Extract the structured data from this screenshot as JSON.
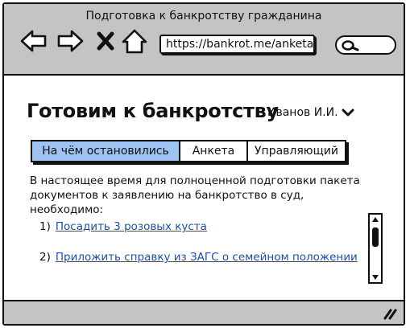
{
  "window": {
    "title": "Подготовка к банкротству гражданина"
  },
  "toolbar": {
    "back_icon": "arrow-left-icon",
    "forward_icon": "arrow-right-icon",
    "stop_icon": "close-icon",
    "home_icon": "home-icon",
    "address": "https://bankrot.me/anketa/i",
    "search_icon": "search-icon"
  },
  "header": {
    "title": "Готовим к банкротству",
    "user": "Иванов И.И."
  },
  "tabs": [
    {
      "label": "На чём остановились",
      "active": true
    },
    {
      "label": "Анкета",
      "active": false
    },
    {
      "label": "Управляющий",
      "active": false
    }
  ],
  "main": {
    "intro": "В настоящее время для полноценной подготовки пакета документов к заявлению на банкротство в суд, необходимо:",
    "items": [
      {
        "num": "1)",
        "text": "Посадить 3 розовых куста"
      },
      {
        "num": "2)",
        "text": "Приложить справку из ЗАГС о семейном положении"
      }
    ]
  },
  "colors": {
    "chrome": "#c4c4c4",
    "active_tab": "#9ec2f2",
    "link": "#1b4fb0"
  }
}
